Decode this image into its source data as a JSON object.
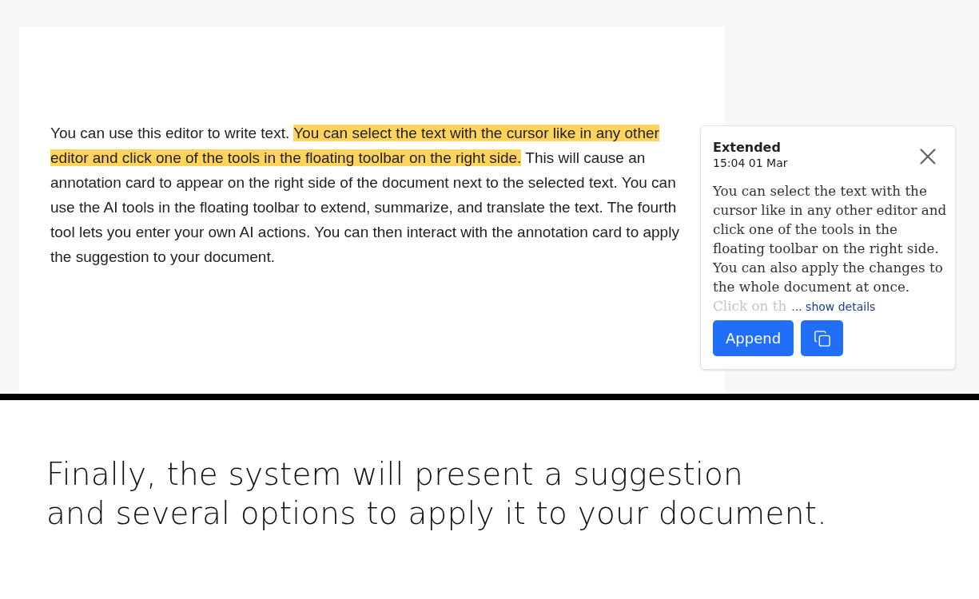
{
  "document": {
    "paragraph": [
      {
        "text": "You can use this editor to write text. ",
        "highlighted": false
      },
      {
        "text": "You can select the text with the cursor like in any other editor and click one of the tools in the floating toolbar on the right side.",
        "highlighted": true
      },
      {
        "text": " This will cause an annotation card to appear on the right side of the document next to the selected text. You can use the AI tools in the floating toolbar to extend, summarize, and translate the text. The fourth tool lets you enter your own AI actions. You can then interact with the annotation card to apply the suggestion to your document.",
        "highlighted": false
      }
    ]
  },
  "annotation_card": {
    "title": "Extended",
    "time": "15:04 01 Mar",
    "body": "You can select the text with the cursor like in any other editor and click one of the tools in the floating toolbar on the right side. You can also apply the changes to the whole document at once. ",
    "body_faded": "Click on th",
    "show_details": "... show details",
    "append_button": "Append"
  },
  "caption": {
    "lines": [
      "Finally, the system will present a suggestion",
      "and several options to apply it to your document."
    ]
  }
}
